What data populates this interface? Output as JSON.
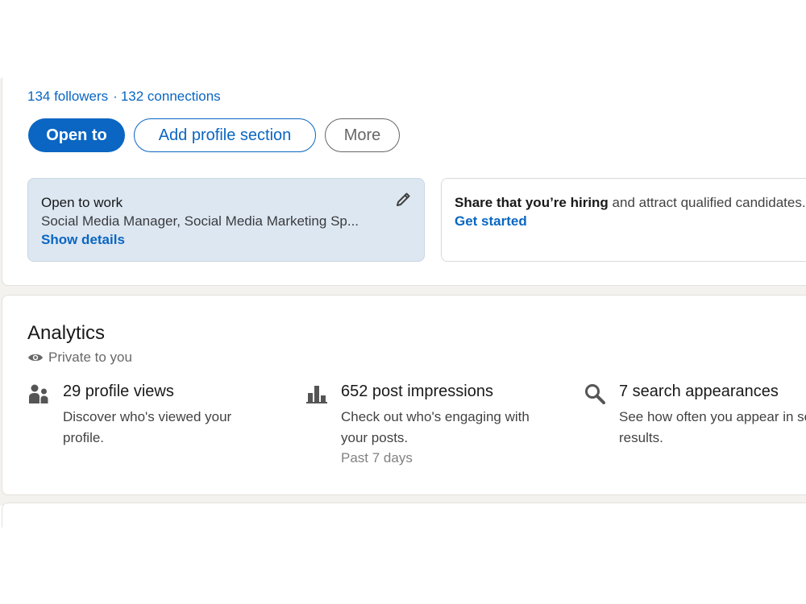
{
  "profile": {
    "followers": "134 followers",
    "separator": "·",
    "connections": "132 connections"
  },
  "actions": {
    "open_to": "Open to",
    "add_profile_section": "Add profile section",
    "more": "More"
  },
  "open_to_work": {
    "title": "Open to work",
    "roles": "Social Media Manager, Social Media Marketing Sp...",
    "link": "Show details"
  },
  "hiring": {
    "bold": "Share that you’re hiring",
    "rest": " and attract qualified candidates.",
    "link": "Get started"
  },
  "analytics": {
    "title": "Analytics",
    "visibility": "Private to you",
    "metrics": [
      {
        "icon": "people-icon",
        "headline": "29 profile views",
        "description": "Discover who's viewed your profile.",
        "sub": ""
      },
      {
        "icon": "bar-chart-icon",
        "headline": "652 post impressions",
        "description": "Check out who's engaging with your posts.",
        "sub": "Past 7 days"
      },
      {
        "icon": "search-icon",
        "headline": "7 search appearances",
        "description": "See how often you appear in search results.",
        "sub": ""
      }
    ]
  },
  "colors": {
    "primary": "#0a66c2",
    "open_to_work_bg": "#dde7f1",
    "page_bg": "#f4f2ee"
  }
}
